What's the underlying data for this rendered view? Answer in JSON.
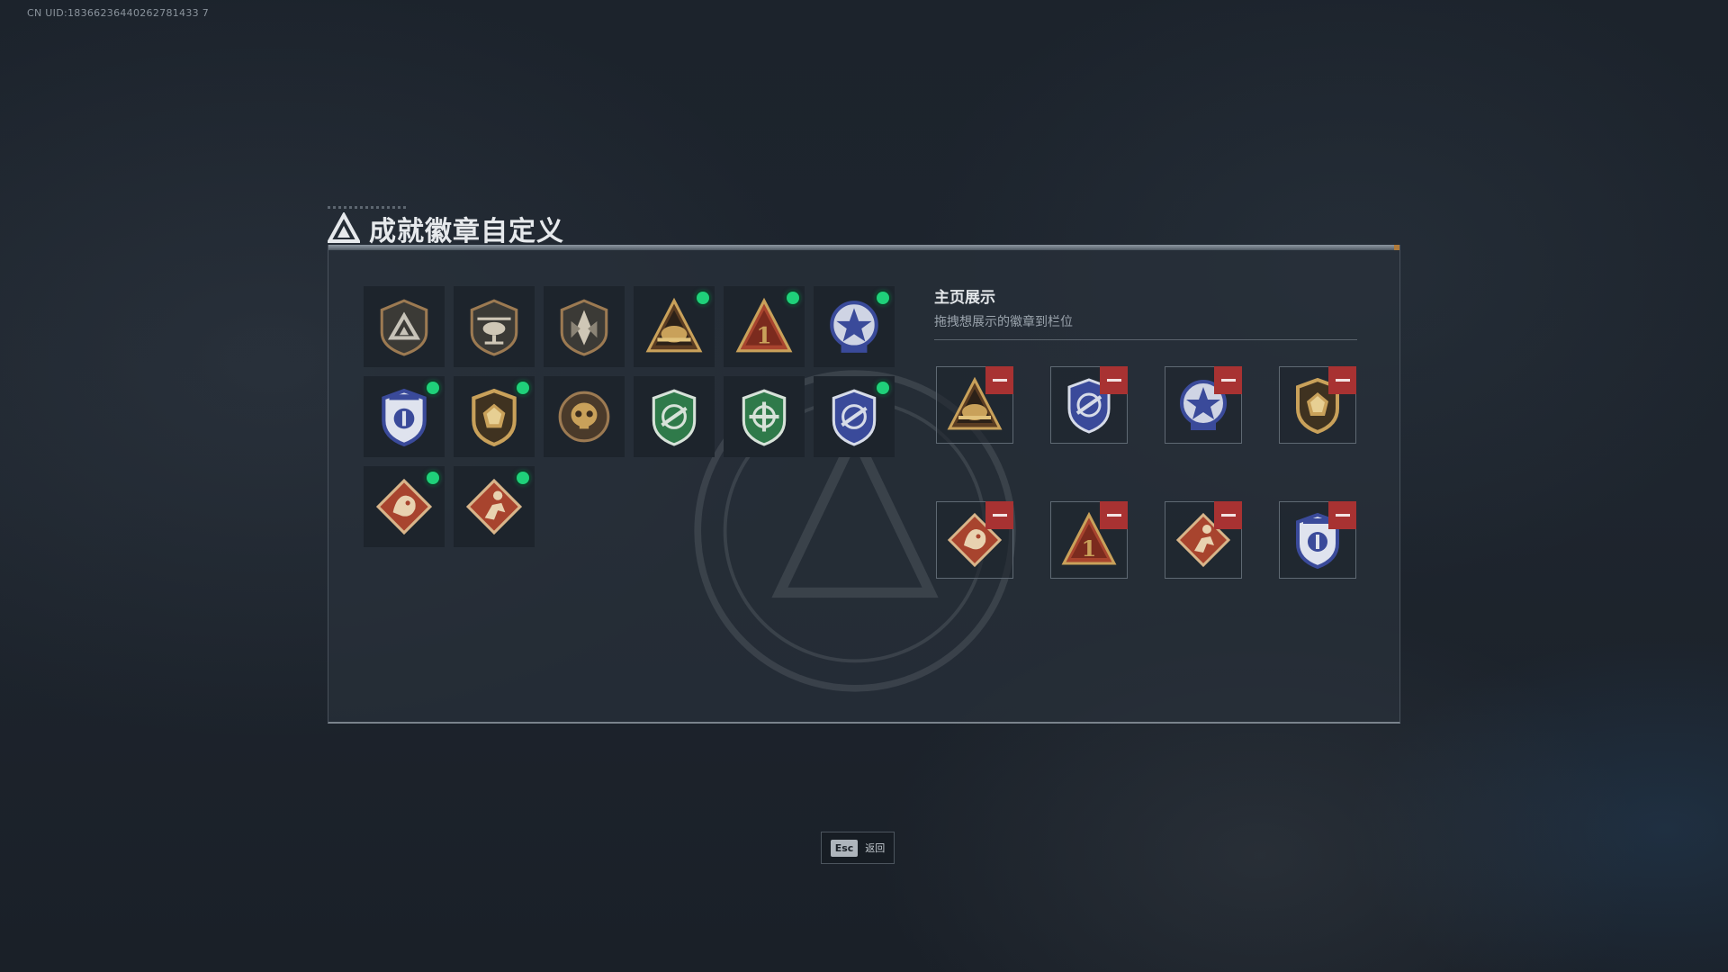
{
  "uid_text": "CN UID:18366236440262781433 7",
  "page": {
    "title": "成就徽章自定义"
  },
  "achievements": {
    "badges": [
      {
        "icon": "triangle-shield-badge-icon",
        "is_new": false
      },
      {
        "icon": "helicopter-shield-badge-icon",
        "is_new": false
      },
      {
        "icon": "spearhead-shield-badge-icon",
        "is_new": false
      },
      {
        "icon": "gold-helmet-triangle-badge-icon",
        "is_new": true
      },
      {
        "icon": "red-number-one-triangle-badge-icon",
        "is_new": true
      },
      {
        "icon": "blue-star-medal-badge-icon",
        "is_new": true
      },
      {
        "icon": "blue-police-shield-badge-icon",
        "is_new": true
      },
      {
        "icon": "gold-crystal-shield-badge-icon",
        "is_new": true
      },
      {
        "icon": "bronze-skull-badge-icon",
        "is_new": false
      },
      {
        "icon": "green-rifle-shield-badge-icon",
        "is_new": false
      },
      {
        "icon": "green-crosshair-shield-badge-icon",
        "is_new": false
      },
      {
        "icon": "blue-rifle-shield-badge-icon",
        "is_new": true
      },
      {
        "icon": "red-dragon-diamond-badge-icon",
        "is_new": true
      },
      {
        "icon": "red-runner-diamond-badge-icon",
        "is_new": true
      }
    ]
  },
  "showcase": {
    "heading": "主页展示",
    "subtitle": "拖拽想展示的徽章到栏位",
    "slots": [
      {
        "icon": "gold-helmet-triangle-badge-icon"
      },
      {
        "icon": "blue-rifle-shield-badge-icon"
      },
      {
        "icon": "blue-star-medal-badge-icon"
      },
      {
        "icon": "gold-crystal-shield-badge-icon"
      },
      {
        "icon": "red-dragon-diamond-badge-icon"
      },
      {
        "icon": "red-number-one-triangle-badge-icon"
      },
      {
        "icon": "red-runner-diamond-badge-icon"
      },
      {
        "icon": "blue-police-shield-badge-icon"
      }
    ]
  },
  "footer": {
    "esc_key": "Esc",
    "esc_label": "返回"
  },
  "colors": {
    "new_indicator": "#1fd17a",
    "remove_button": "#a83232",
    "gold": "#c9a15a",
    "bronze": "#9c7a52",
    "red": "#a8442e",
    "blue": "#3a4a9a",
    "green": "#2f7a4a"
  }
}
